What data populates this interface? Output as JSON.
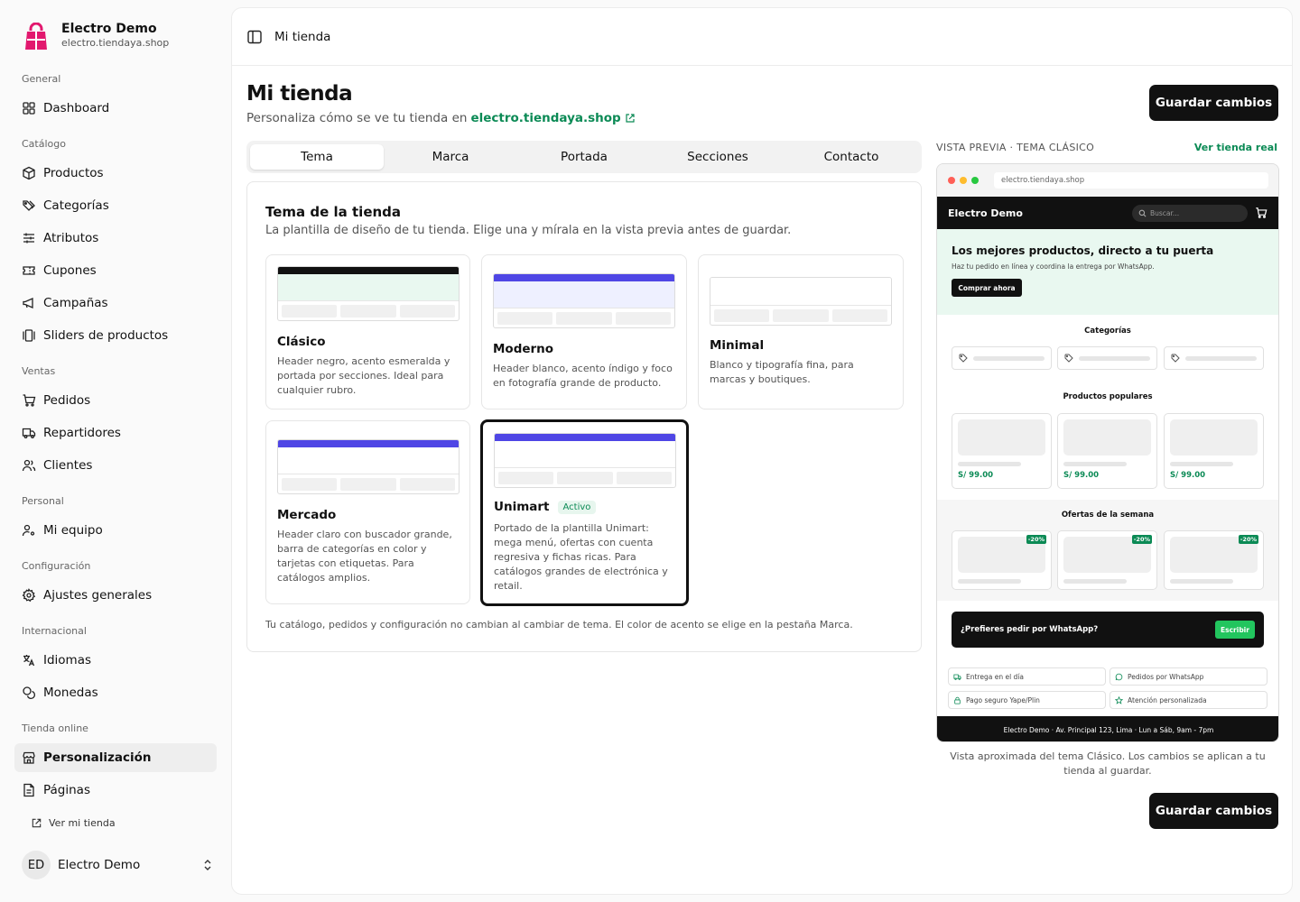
{
  "brand": {
    "name": "Electro Demo",
    "domain": "electro.tiendaya.shop",
    "accent": "#e2186e"
  },
  "sidebar": {
    "groups": [
      {
        "heading": "General",
        "items": [
          {
            "label": "Dashboard",
            "icon": "dashboard-icon"
          }
        ]
      },
      {
        "heading": "Catálogo",
        "items": [
          {
            "label": "Productos",
            "icon": "box-icon"
          },
          {
            "label": "Categorías",
            "icon": "tags-icon"
          },
          {
            "label": "Atributos",
            "icon": "sliders-icon"
          },
          {
            "label": "Cupones",
            "icon": "ticket-icon"
          },
          {
            "label": "Campañas",
            "icon": "megaphone-icon"
          },
          {
            "label": "Sliders de productos",
            "icon": "gallery-icon"
          }
        ]
      },
      {
        "heading": "Ventas",
        "items": [
          {
            "label": "Pedidos",
            "icon": "cart-icon"
          },
          {
            "label": "Repartidores",
            "icon": "truck-icon"
          },
          {
            "label": "Clientes",
            "icon": "users-icon"
          }
        ]
      },
      {
        "heading": "Personal",
        "items": [
          {
            "label": "Mi equipo",
            "icon": "user-cog-icon"
          }
        ]
      },
      {
        "heading": "Configuración",
        "items": [
          {
            "label": "Ajustes generales",
            "icon": "settings-icon"
          }
        ]
      },
      {
        "heading": "Internacional",
        "items": [
          {
            "label": "Idiomas",
            "icon": "languages-icon"
          },
          {
            "label": "Monedas",
            "icon": "coins-icon"
          }
        ]
      },
      {
        "heading": "Tienda online",
        "items": [
          {
            "label": "Personalización",
            "icon": "store-icon",
            "active": true
          },
          {
            "label": "Páginas",
            "icon": "file-icon"
          }
        ]
      }
    ],
    "view_store": "Ver mi tienda",
    "user": {
      "initials": "ED",
      "name": "Electro Demo"
    }
  },
  "topbar": {
    "title": "Mi tienda"
  },
  "page": {
    "title": "Mi tienda",
    "subtitle": "Personaliza cómo se ve tu tienda en",
    "link": "electro.tiendaya.shop",
    "save_label": "Guardar cambios"
  },
  "tabs": [
    {
      "label": "Tema",
      "active": true
    },
    {
      "label": "Marca"
    },
    {
      "label": "Portada"
    },
    {
      "label": "Secciones"
    },
    {
      "label": "Contacto"
    }
  ],
  "theme": {
    "title": "Tema de la tienda",
    "subtitle": "La plantilla de diseño de tu tienda. Elige una y mírala en la vista previa antes de guardar.",
    "footnote": "Tu catálogo, pedidos y configuración no cambian al cambiar de tema. El color de acento se elige en la pestaña Marca.",
    "options": [
      {
        "name": "Clásico",
        "desc": "Header negro, acento esmeralda y portada por secciones. Ideal para cualquier rubro.",
        "bar": "#111111",
        "hero": "#e9f8f0"
      },
      {
        "name": "Moderno",
        "desc": "Header blanco, acento índigo y foco en fotografía grande de producto.",
        "bar": "#4f46e5",
        "hero": "#eef0ff"
      },
      {
        "name": "Minimal",
        "desc": "Blanco y tipografía fina, para marcas y boutiques.",
        "bar": "#ffffff",
        "hero": "#ffffff"
      },
      {
        "name": "Mercado",
        "desc": "Header claro con buscador grande, barra de categorías en color y tarjetas con etiquetas. Para catálogos amplios.",
        "bar": "#4f46e5",
        "hero": "#ffffff"
      },
      {
        "name": "Unimart",
        "badge": "Activo",
        "desc": "Portado de la plantilla Unimart: mega menú, ofertas con cuenta regresiva y fichas ricas. Para catálogos grandes de electrónica y retail.",
        "bar": "#4f46e5",
        "hero": "#ffffff",
        "selected": true
      }
    ]
  },
  "preview": {
    "label": "VISTA PREVIA · TEMA CLÁSICO",
    "link": "Ver tienda real",
    "url": "electro.tiendaya.shop",
    "store": "Electro Demo",
    "search_placeholder": "Buscar...",
    "hero_title": "Los mejores productos, directo a tu puerta",
    "hero_sub": "Haz tu pedido en línea y coordina la entrega por WhatsApp.",
    "hero_btn": "Comprar ahora",
    "categories_title": "Categorías",
    "popular_title": "Productos populares",
    "prices": [
      "S/ 99.00",
      "S/ 99.00",
      "S/ 99.00"
    ],
    "offers_title": "Ofertas de la semana",
    "discounts": [
      "-20%",
      "-20%",
      "-20%"
    ],
    "wa_text": "¿Prefieres pedir por WhatsApp?",
    "wa_btn": "Escribir",
    "features": [
      "Entrega en el día",
      "Pedidos por WhatsApp",
      "Pago seguro Yape/Plin",
      "Atención personalizada"
    ],
    "footer": "Electro Demo · Av. Principal 123, Lima · Lun a Sáb, 9am - 7pm",
    "caption": "Vista aproximada del tema Clásico. Los cambios se aplican a tu tienda al guardar."
  }
}
